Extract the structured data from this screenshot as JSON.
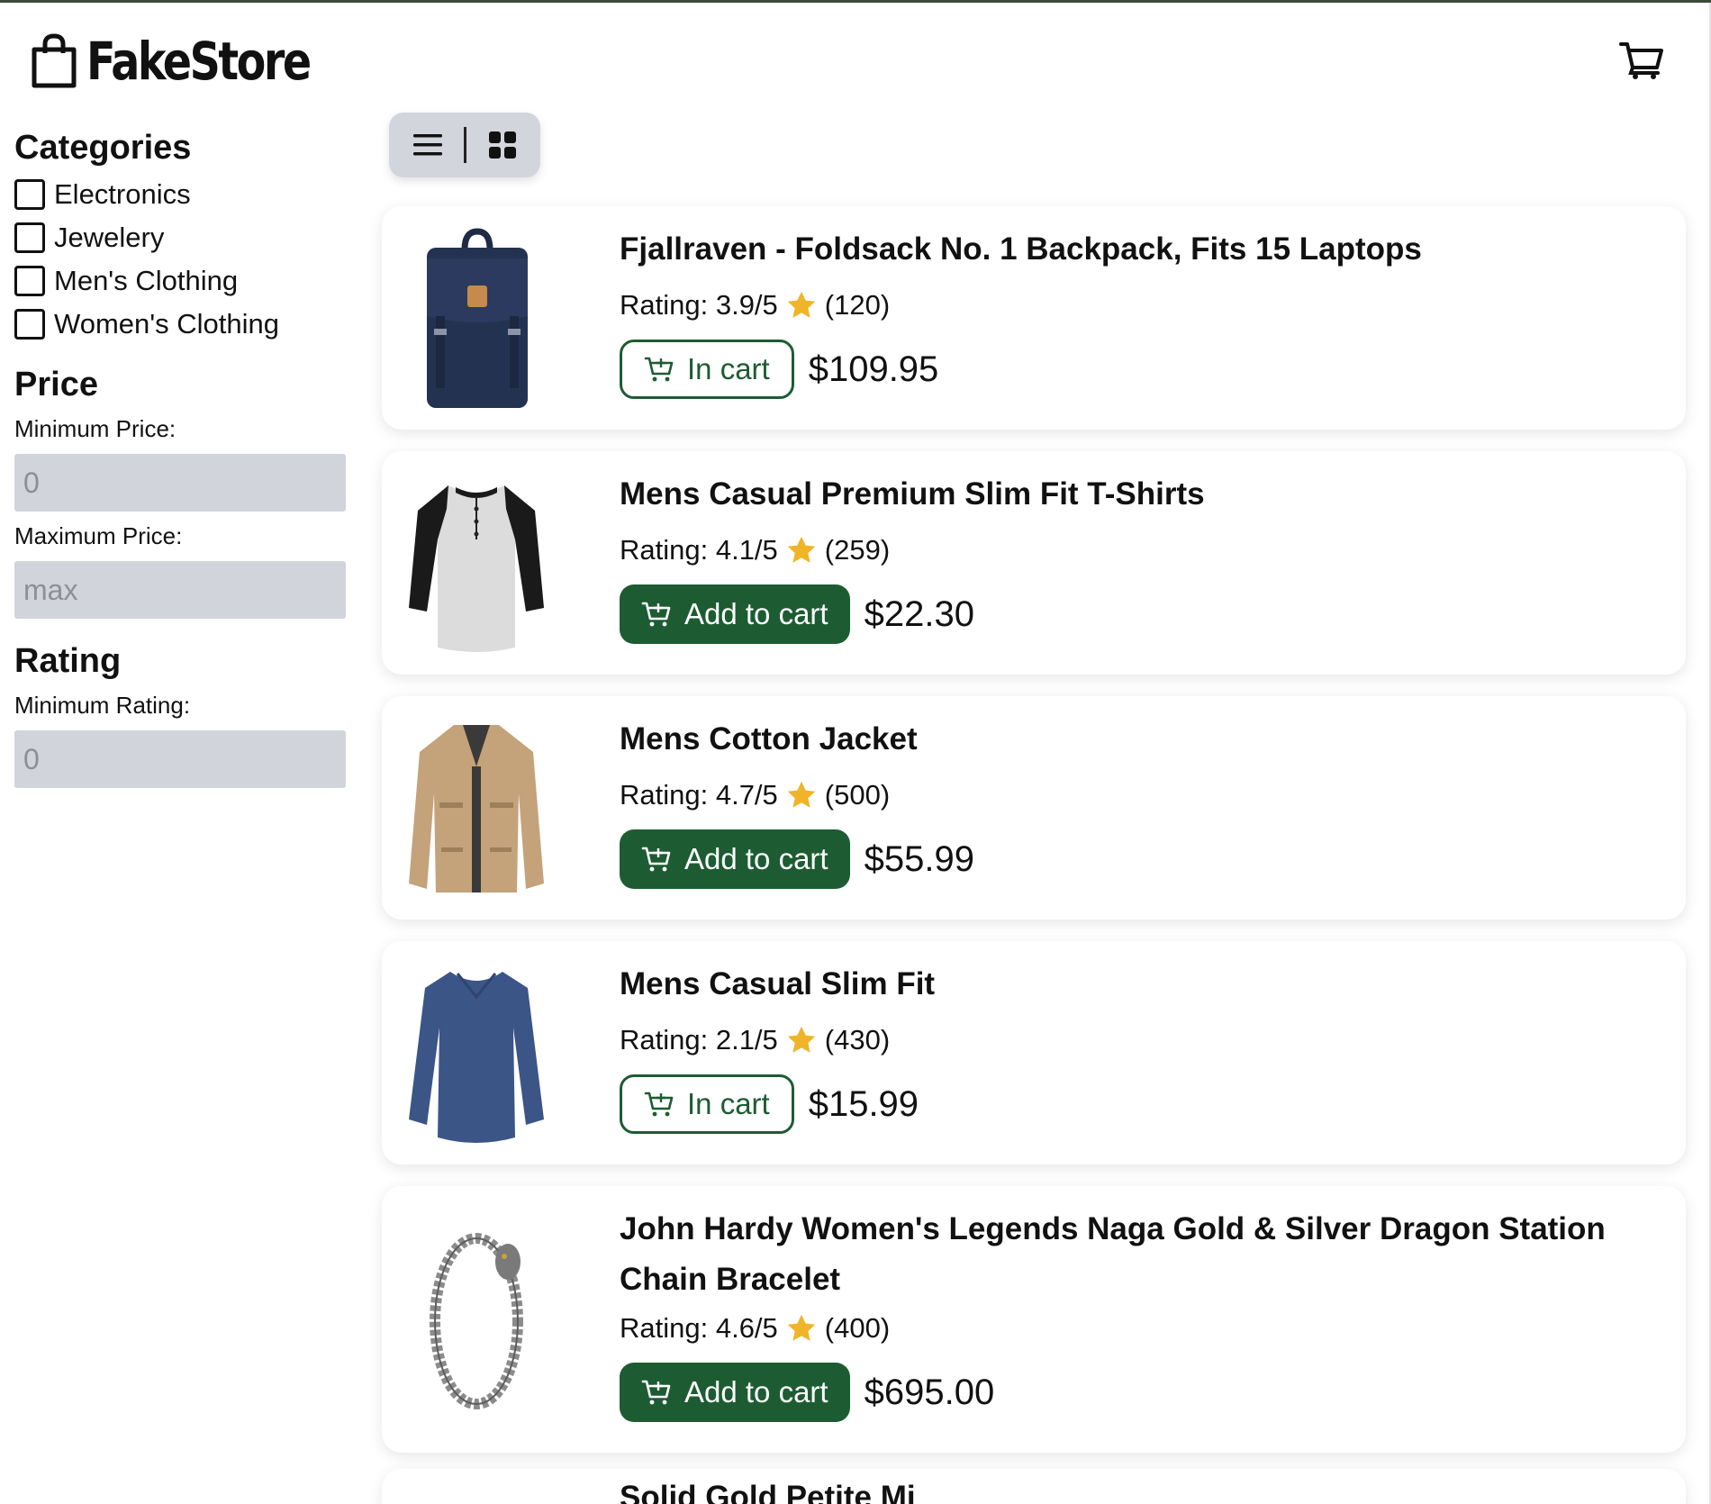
{
  "header": {
    "logo_text": "FakeStore",
    "logo_icon": "shopping-bag-icon",
    "cart_icon": "shopping-cart-icon"
  },
  "sidebar": {
    "categories_title": "Categories",
    "categories": [
      {
        "label": "Electronics",
        "checked": false
      },
      {
        "label": "Jewelery",
        "checked": false
      },
      {
        "label": "Men's Clothing",
        "checked": false
      },
      {
        "label": "Women's Clothing",
        "checked": false
      }
    ],
    "price_title": "Price",
    "min_price_label": "Minimum Price:",
    "min_price_placeholder": "0",
    "max_price_label": "Maximum Price:",
    "max_price_placeholder": "max",
    "rating_title": "Rating",
    "min_rating_label": "Minimum Rating:",
    "min_rating_placeholder": "0"
  },
  "view_toggle": {
    "list_icon": "list-view-icon",
    "grid_icon": "grid-view-icon"
  },
  "products": [
    {
      "title": "Fjallraven - Foldsack No. 1 Backpack, Fits 15 Laptops",
      "rating_text": "Rating: 3.9/5",
      "count_text": "(120)",
      "in_cart": true,
      "button_label": "In cart",
      "price": "$109.95",
      "image": "backpack"
    },
    {
      "title": "Mens Casual Premium Slim Fit T-Shirts",
      "rating_text": "Rating: 4.1/5",
      "count_text": "(259)",
      "in_cart": false,
      "button_label": "Add to cart",
      "price": "$22.30",
      "image": "tshirt"
    },
    {
      "title": "Mens Cotton Jacket",
      "rating_text": "Rating: 4.7/5",
      "count_text": "(500)",
      "in_cart": false,
      "button_label": "Add to cart",
      "price": "$55.99",
      "image": "jacket"
    },
    {
      "title": "Mens Casual Slim Fit",
      "rating_text": "Rating: 2.1/5",
      "count_text": "(430)",
      "in_cart": true,
      "button_label": "In cart",
      "price": "$15.99",
      "image": "longsleeve"
    },
    {
      "title": "John Hardy Women's Legends Naga Gold & Silver Dragon Station Chain Bracelet",
      "rating_text": "Rating: 4.6/5",
      "count_text": "(400)",
      "in_cart": false,
      "button_label": "Add to cart",
      "price": "$695.00",
      "image": "bracelet"
    }
  ],
  "partial_product": {
    "title": "Solid Gold Petite Mi"
  },
  "colors": {
    "accent": "#1d5c32",
    "star": "#f0b429",
    "input_bg": "#d2d4dc",
    "toggle_bg": "#d3d5dd"
  }
}
